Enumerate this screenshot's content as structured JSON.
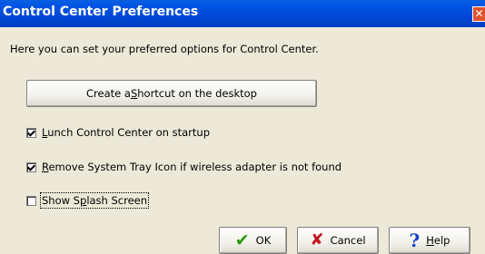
{
  "window": {
    "title": "Control Center Preferences",
    "close_glyph": "✕"
  },
  "intro": "Here you can set your preferred options for Control Center.",
  "shortcut_button": {
    "pre": "Create a ",
    "accel": "S",
    "post": "hortcut on the desktop"
  },
  "options": [
    {
      "accel": "L",
      "rest": "unch Control Center on startup",
      "checked": true
    },
    {
      "accel": "R",
      "rest": "emove System Tray Icon if wireless adapter is not found",
      "checked": true
    },
    {
      "pre": "Show S",
      "accel": "p",
      "rest": "lash Screen",
      "checked": false
    }
  ],
  "buttons": {
    "ok": {
      "label": "OK",
      "icon": "check-icon"
    },
    "cancel": {
      "label": "Cancel",
      "icon": "x-icon"
    },
    "help": {
      "accel": "H",
      "rest": "elp",
      "icon": "question-icon"
    }
  },
  "colors": {
    "titlebar": "#0054e3",
    "face": "#ece9d8",
    "ok_icon": "#2a9a12",
    "cancel_icon": "#c4161c",
    "help_icon": "#1844c8"
  }
}
